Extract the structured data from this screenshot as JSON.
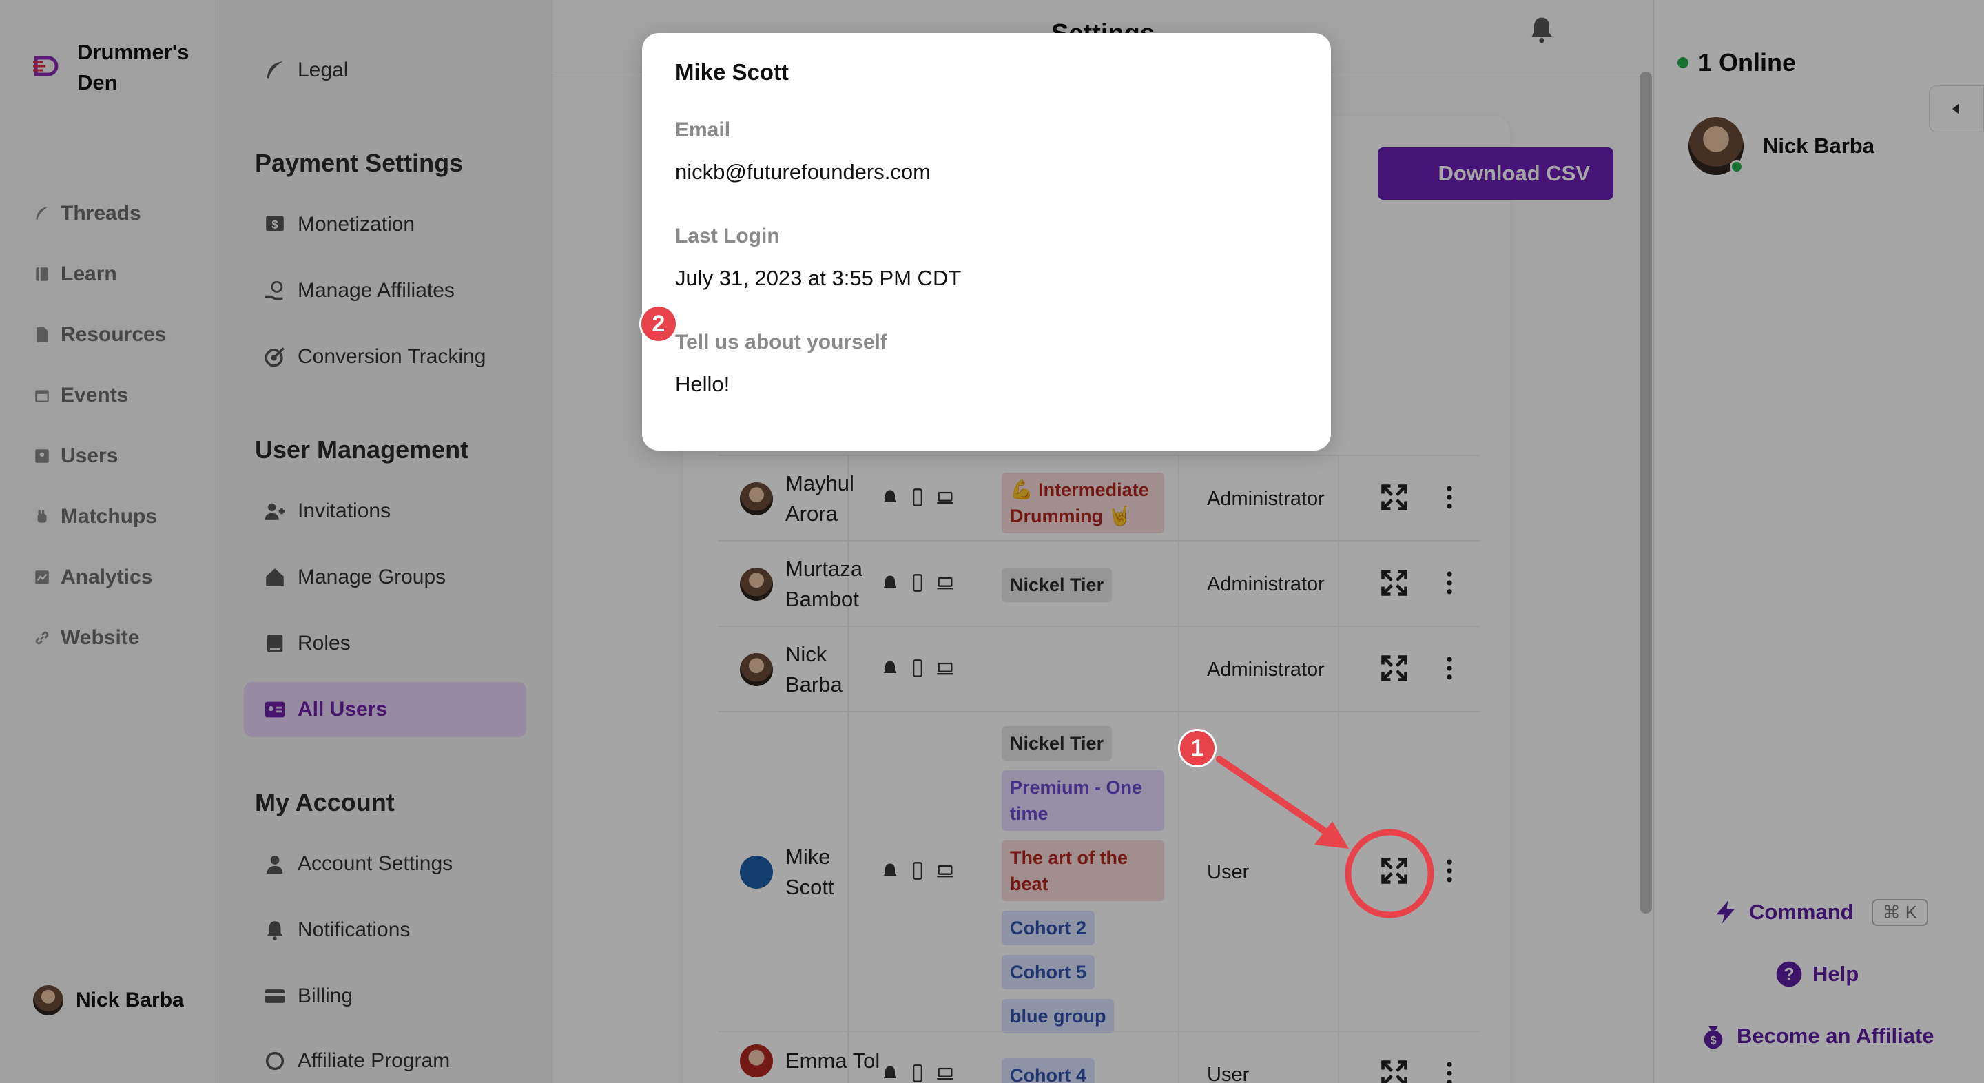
{
  "brand": {
    "name": "Drummer's Den"
  },
  "nav": {
    "items": [
      {
        "label": "Threads",
        "icon": "feather-icon"
      },
      {
        "label": "Learn",
        "icon": "book-icon"
      },
      {
        "label": "Resources",
        "icon": "document-icon"
      },
      {
        "label": "Events",
        "icon": "calendar-icon"
      },
      {
        "label": "Users",
        "icon": "user-card-icon"
      },
      {
        "label": "Matchups",
        "icon": "hand-icon"
      },
      {
        "label": "Analytics",
        "icon": "chart-icon"
      },
      {
        "label": "Website",
        "icon": "link-icon"
      }
    ],
    "current_user": "Nick Barba"
  },
  "settings": {
    "legal": "Legal",
    "payment_heading": "Payment Settings",
    "monetization": "Monetization",
    "manage_affiliates": "Manage Affiliates",
    "conversion_tracking": "Conversion Tracking",
    "user_mgmt_heading": "User Management",
    "invitations": "Invitations",
    "manage_groups": "Manage Groups",
    "roles": "Roles",
    "all_users": "All Users",
    "my_account_heading": "My Account",
    "account_settings": "Account Settings",
    "notifications": "Notifications",
    "billing": "Billing",
    "affiliate_program": "Affiliate Program"
  },
  "main": {
    "title": "Settings",
    "download_csv": "Download CSV",
    "rows": [
      {
        "name": "Mayhul Arora",
        "tags": [
          "💪 Intermediate Drumming 🤘"
        ],
        "role": "Administrator"
      },
      {
        "name": "Murtaza Bambot",
        "tags": [
          "Nickel Tier"
        ],
        "role": "Administrator"
      },
      {
        "name": "Nick Barba",
        "tags": [],
        "role": "Administrator"
      },
      {
        "name": "Mike Scott",
        "tags": [
          "Nickel Tier",
          "Premium - One time",
          "The art of the beat",
          "Cohort 2",
          "Cohort 5",
          "blue group"
        ],
        "role": "User"
      },
      {
        "name": "Emma Tol",
        "tags": [
          "Cohort 4"
        ],
        "role": "User"
      }
    ]
  },
  "presence": {
    "online_count": "1 Online",
    "online_user": "Nick Barba",
    "command": "Command",
    "command_kbd": "⌘ K",
    "help": "Help",
    "become_affiliate": "Become an Affiliate"
  },
  "modal": {
    "title": "Mike Scott",
    "email_label": "Email",
    "email_value": "nickb@futurefounders.com",
    "last_login_label": "Last Login",
    "last_login_value": "July 31, 2023 at 3:55 PM CDT",
    "about_label": "Tell us about yourself",
    "about_value": "Hello!"
  },
  "annotations": {
    "badge_1": "1",
    "badge_2": "2"
  },
  "colors": {
    "accent": "#6a1fb5",
    "annotation": "#e8434a",
    "online": "#22b04b"
  }
}
